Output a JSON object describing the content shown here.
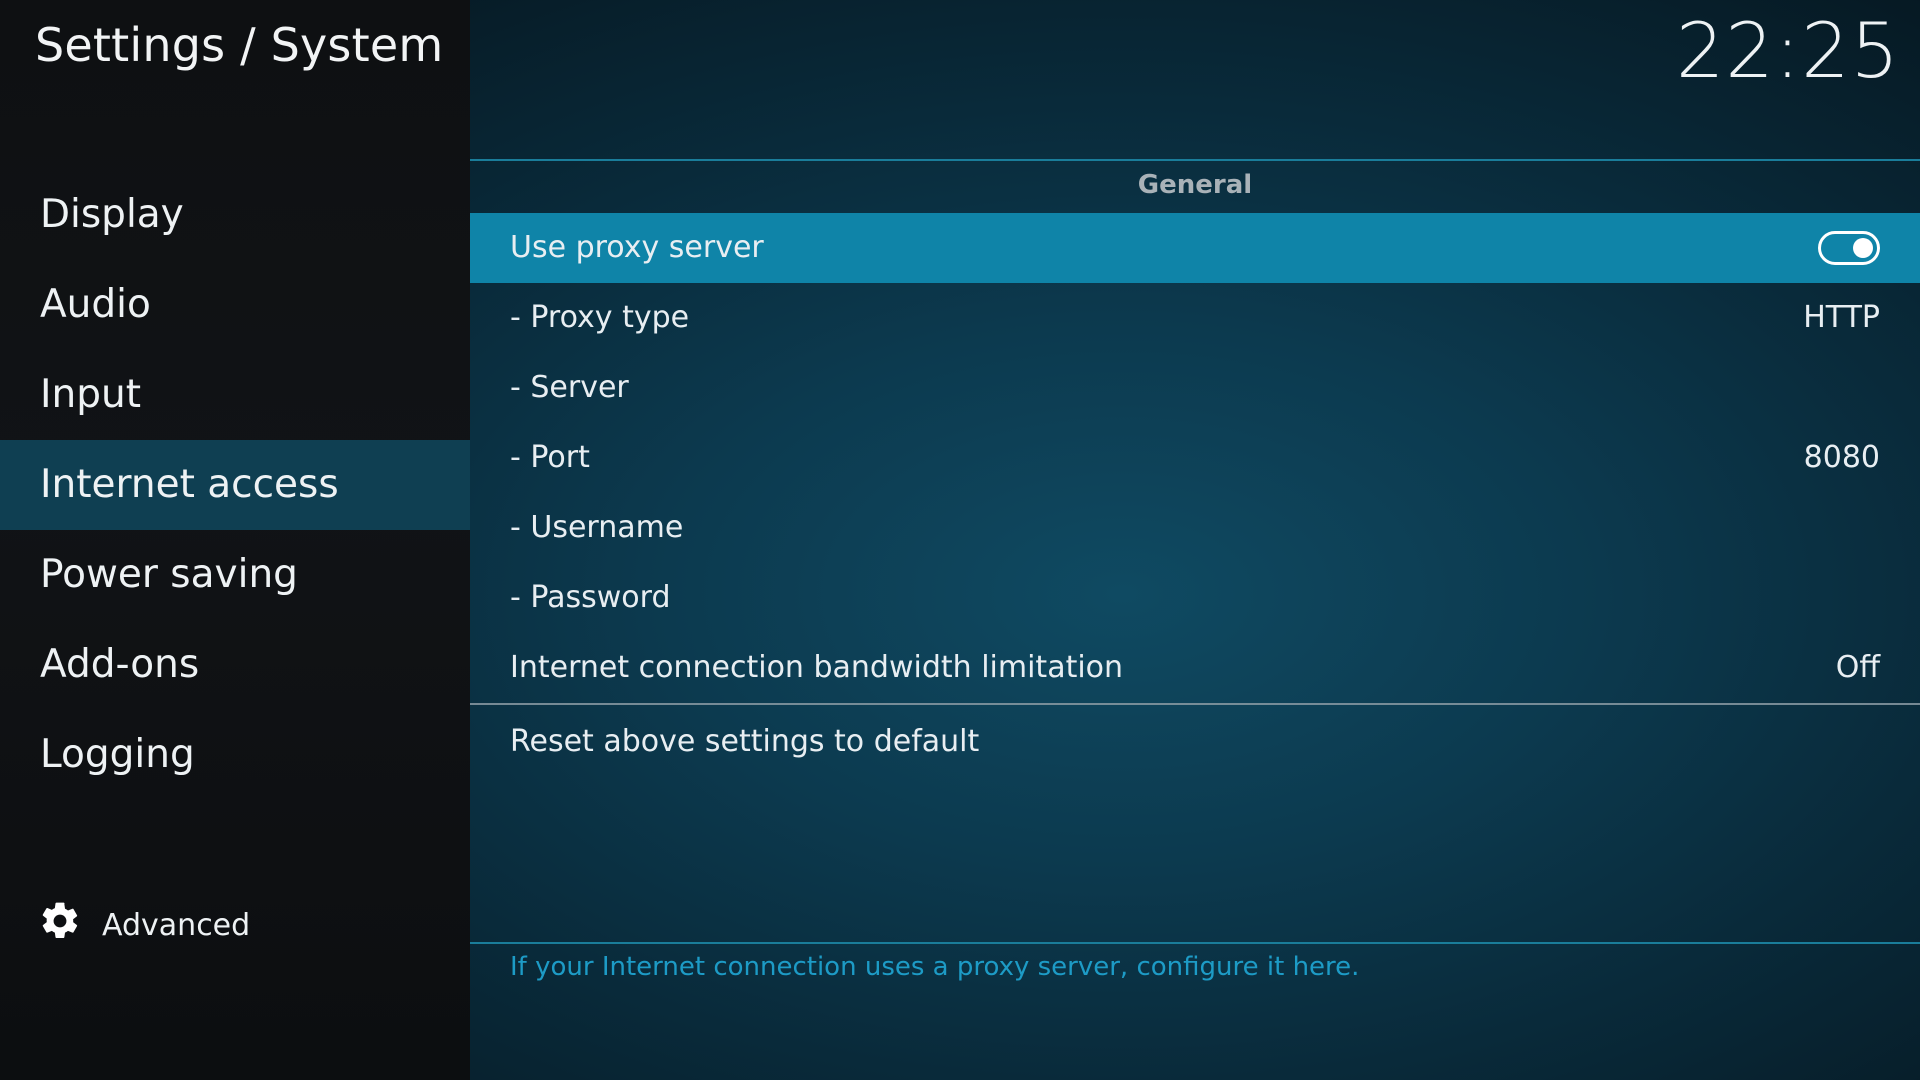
{
  "header": {
    "breadcrumb": "Settings / System",
    "clock": "22:25"
  },
  "sidebar": {
    "items": [
      {
        "label": "Display"
      },
      {
        "label": "Audio"
      },
      {
        "label": "Input"
      },
      {
        "label": "Internet access",
        "active": true
      },
      {
        "label": "Power saving"
      },
      {
        "label": "Add-ons"
      },
      {
        "label": "Logging"
      }
    ],
    "advanced": {
      "label": "Advanced",
      "icon": "gear-icon",
      "level": "Advanced"
    }
  },
  "main": {
    "section_title": "General",
    "settings": [
      {
        "label": "Use proxy server",
        "type": "toggle",
        "value_on": true,
        "focused": true
      },
      {
        "label": "- Proxy type",
        "value": "HTTP"
      },
      {
        "label": "- Server",
        "value": ""
      },
      {
        "label": "- Port",
        "value": "8080"
      },
      {
        "label": "- Username",
        "value": ""
      },
      {
        "label": "- Password",
        "value": ""
      },
      {
        "label": "Internet connection bandwidth limitation",
        "value": "Off"
      }
    ],
    "reset_label": "Reset above settings to default",
    "description": "If your Internet connection uses a proxy server, configure it here."
  },
  "colors": {
    "focus": "#0f84a8",
    "active_nav": "#0f3f52",
    "accent_line": "#1a7d9a",
    "description_text": "#1d9bc6"
  }
}
